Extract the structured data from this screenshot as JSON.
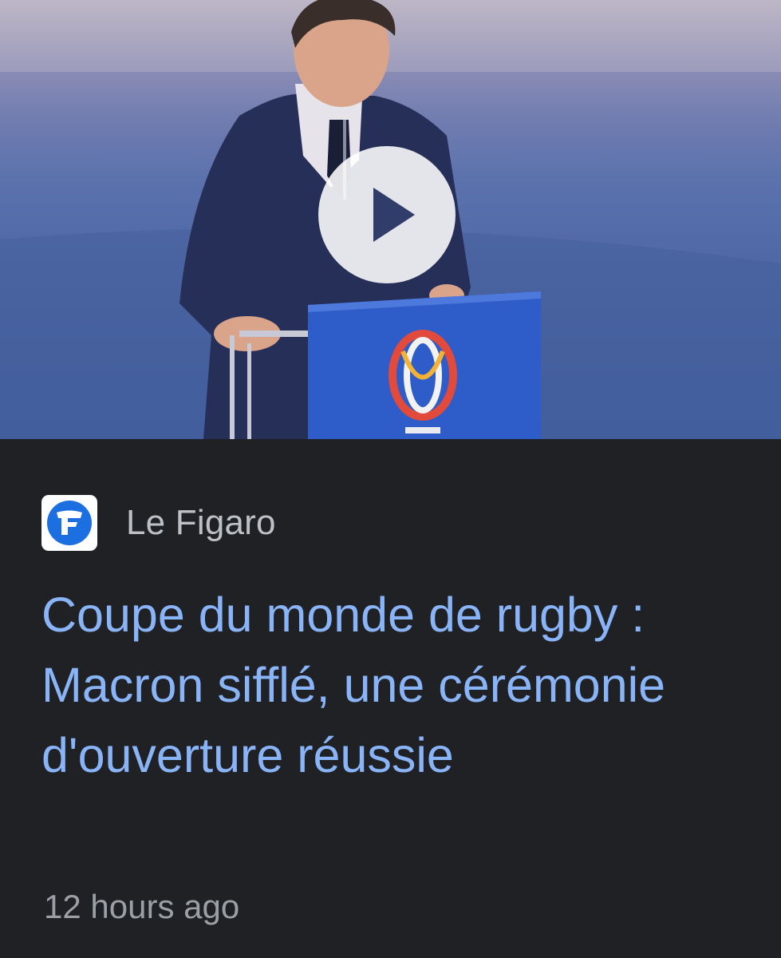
{
  "video": {
    "play_icon": "play-icon",
    "podium_logo_icon": "rugby-world-cup-logo-icon"
  },
  "article": {
    "source_name": "Le Figaro",
    "source_logo_icon": "le-figaro-logo-icon",
    "source_logo_letter": "F",
    "headline": "Coupe du monde de rugby : Macron sifflé, une cérémonie d'ouverture réussie",
    "timestamp": "12 hours ago"
  },
  "colors": {
    "background": "#202124",
    "headline": "#8ab4f8",
    "source_text": "#bdc1c6",
    "timestamp": "#9aa0a6",
    "logo_blue": "#1b6fe0",
    "podium_blue": "#2e5cc9"
  }
}
